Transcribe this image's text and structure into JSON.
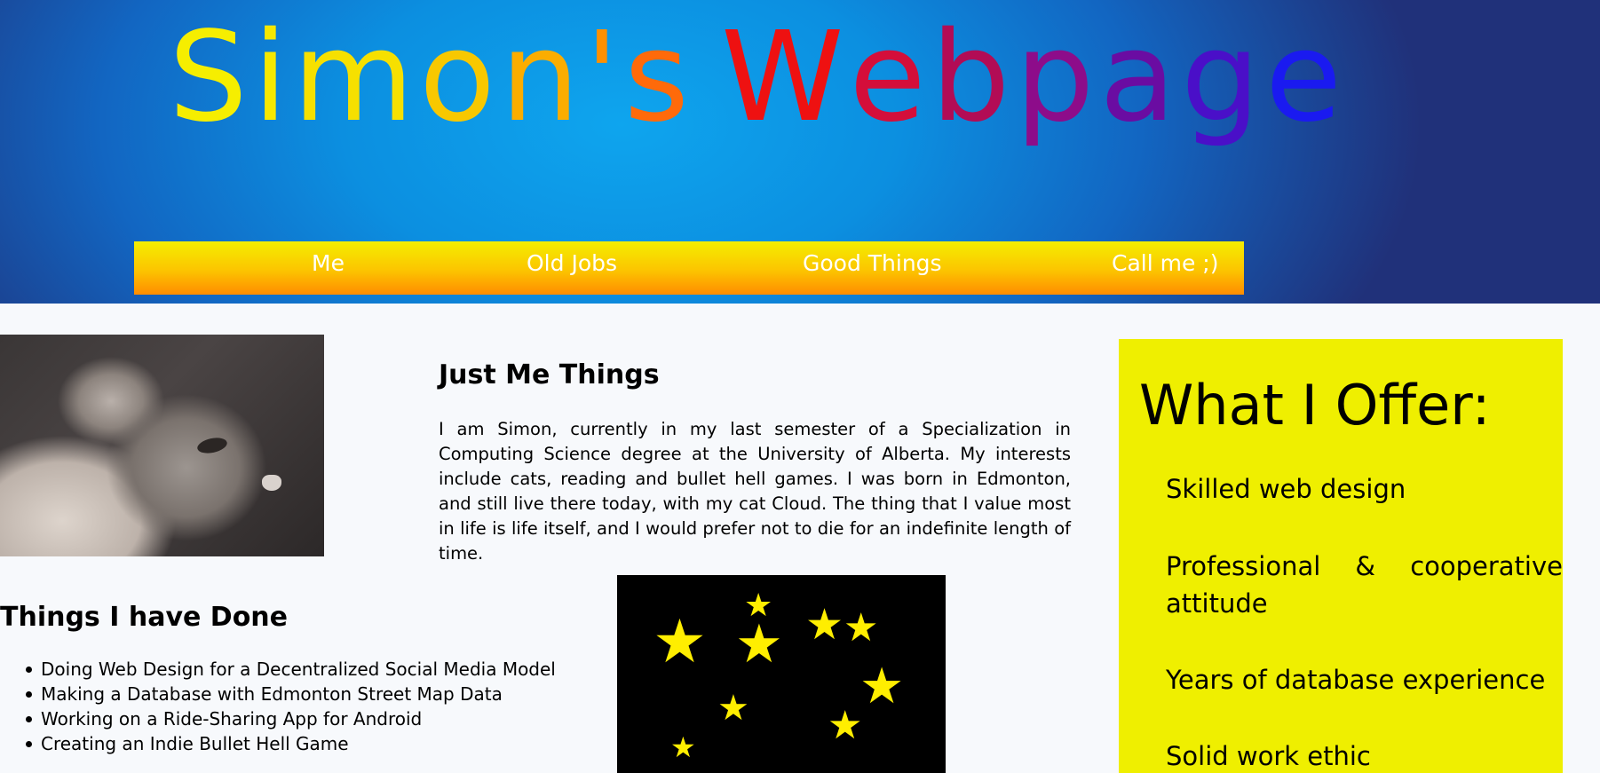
{
  "header": {
    "title_letters": [
      {
        "char": "S",
        "color": "#f6ee00"
      },
      {
        "char": "i",
        "color": "#f6e800"
      },
      {
        "char": "m",
        "color": "#f6e000"
      },
      {
        "char": "o",
        "color": "#f8c800"
      },
      {
        "char": "n",
        "color": "#fbad00"
      },
      {
        "char": "'",
        "color": "#ff9000"
      },
      {
        "char": "s",
        "color": "#ff6a0a"
      },
      {
        "char": " ",
        "color": "#ffffff"
      },
      {
        "char": "W",
        "color": "#ee1111"
      },
      {
        "char": "e",
        "color": "#d40e3a"
      },
      {
        "char": "b",
        "color": "#b20c55"
      },
      {
        "char": "p",
        "color": "#8d0c8a"
      },
      {
        "char": "a",
        "color": "#6a0ca2"
      },
      {
        "char": "g",
        "color": "#4a0fc8"
      },
      {
        "char": "e",
        "color": "#1a1af0"
      }
    ],
    "nav": [
      {
        "label": "Me"
      },
      {
        "label": "Old Jobs"
      },
      {
        "label": "Good Things"
      },
      {
        "label": "Call me ;)"
      }
    ]
  },
  "about": {
    "heading": "Just Me Things",
    "text": "I am Simon, currently in my last semester of a Specialization in Computing Science degree at the University of Alberta. My interests include cats, reading and bullet hell games. I was born in Edmonton, and still live there today, with my cat Cloud. The thing that I value most in life is life itself, and I would prefer not to die for an indefinite length of time."
  },
  "done": {
    "heading": "Things I have Done",
    "items": [
      "Doing Web Design for a Decentralized Social Media Model",
      "Making a Database with Edmonton Street Map Data",
      "Working on a Ride-Sharing App for Android",
      "Creating an Indie Bullet Hell Game"
    ]
  },
  "offer": {
    "title": "What I Offer:",
    "items": [
      "Skilled web design",
      "Professional & cooperative attitude",
      "Years of database experience",
      "Solid work ethic"
    ]
  },
  "colors": {
    "nav_text": "#ffffff",
    "offer_background": "#efef00",
    "star_color": "#ffee00"
  }
}
